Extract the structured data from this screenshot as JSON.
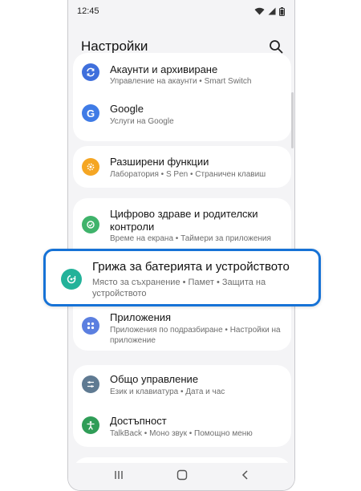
{
  "status_bar": {
    "time": "12:45"
  },
  "header": {
    "title": "Настройки"
  },
  "items": {
    "accounts": {
      "title": "Акаунти и архивиране",
      "subtitle": "Управление на акаунти  •  Smart Switch",
      "color": "#3f6fdc"
    },
    "google": {
      "title": "Google",
      "subtitle": "Услуги на Google",
      "color": "#3f7be6"
    },
    "advanced": {
      "title": "Разширени функции",
      "subtitle": "Лаборатория  •  S Pen  •  Страничен клавиш",
      "color": "#f5a623"
    },
    "wellbeing": {
      "title": "Цифрово здраве и родителски контроли",
      "subtitle": "Време на екрана  •  Таймери за приложения",
      "color": "#3fb36b"
    },
    "battery": {
      "title": "Грижа за батерията и устройството",
      "subtitle": "Място за съхранение  •  Памет  •  Защита на устройството",
      "color": "#23b29a"
    },
    "apps": {
      "title": "Приложения",
      "subtitle": "Приложения по подразбиране  •  Настройки на приложение",
      "color": "#5b7fe0"
    },
    "general": {
      "title": "Общо управление",
      "subtitle": "Език и клавиатура  •  Дата и час",
      "color": "#5f7a92"
    },
    "accessibility": {
      "title": "Достъпност",
      "subtitle": "TalkBack  •  Моно звук  •  Помощно меню",
      "color": "#2f9d57"
    }
  },
  "colors": {
    "highlight_border": "#1672d6",
    "background": "#f4f4f6"
  }
}
